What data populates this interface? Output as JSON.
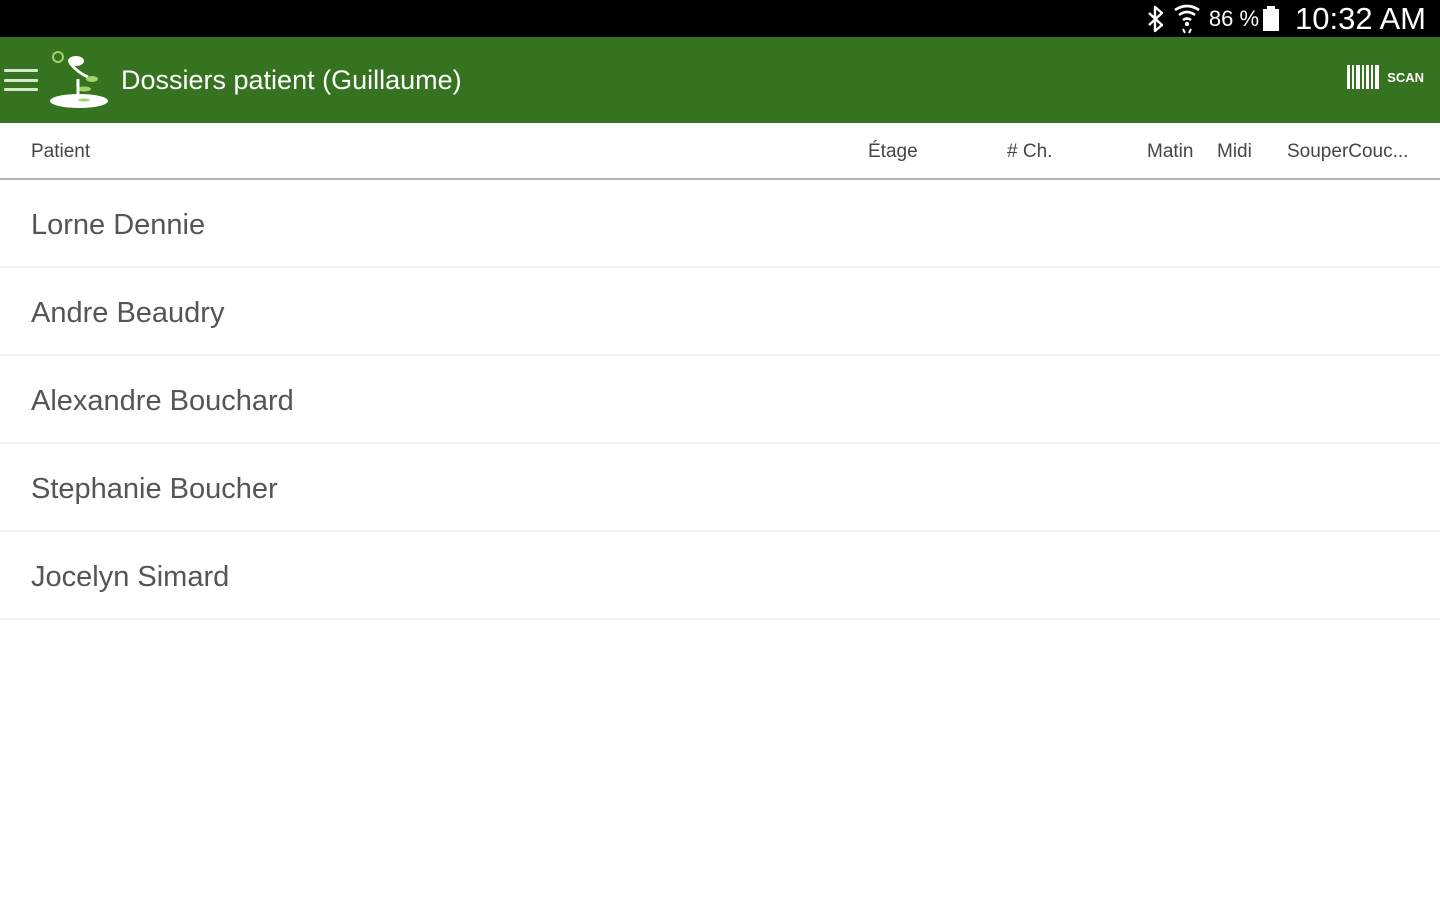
{
  "status_bar": {
    "battery": "86 %",
    "time": "10:32 AM",
    "icons": [
      "bluetooth-icon",
      "wifi-icon",
      "battery-icon"
    ]
  },
  "app_bar": {
    "title": "Dossiers patient (Guillaume)",
    "scan_label": "SCAN",
    "color": "#367320"
  },
  "table": {
    "headers": {
      "patient": "Patient",
      "etage": "Étage",
      "chambre": "# Ch.",
      "matin": "Matin",
      "midi": "Midi",
      "souper": "SouperCouc..."
    },
    "rows": [
      {
        "name": "Lorne Dennie"
      },
      {
        "name": "Andre Beaudry"
      },
      {
        "name": "Alexandre Bouchard"
      },
      {
        "name": "Stephanie Boucher"
      },
      {
        "name": "Jocelyn Simard"
      }
    ]
  }
}
